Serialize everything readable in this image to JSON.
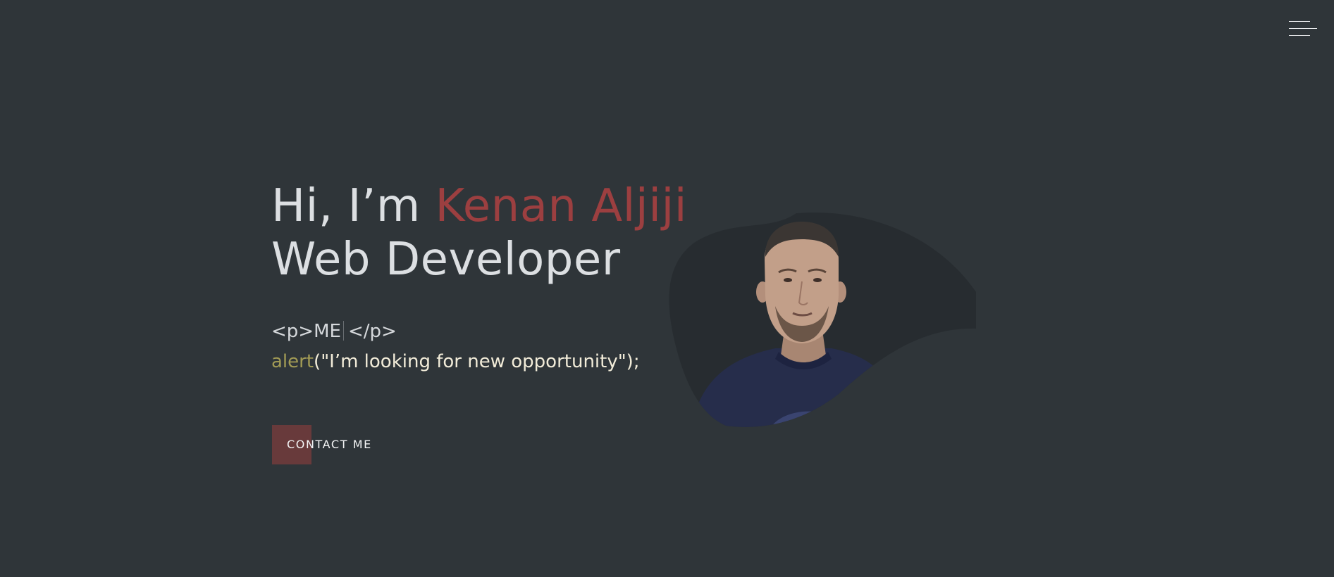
{
  "header": {
    "menu_icon": "hamburger-menu-icon"
  },
  "hero": {
    "greeting": "Hi, I’m ",
    "name": "Kenan Aljiji",
    "role": "Web Developer",
    "tag_open": "<p>ME",
    "tag_close": "</p>",
    "alert_fn": "alert",
    "alert_args": "(\"I’m looking for new opportunity\");"
  },
  "cta": {
    "label": "CONTACT ME"
  },
  "colors": {
    "background": "#2f3539",
    "accent": "#9c3f40",
    "button": "#683a3b",
    "blob": "#272c30",
    "alert_fn": "#a29b55",
    "text": "#dcdfe2"
  }
}
